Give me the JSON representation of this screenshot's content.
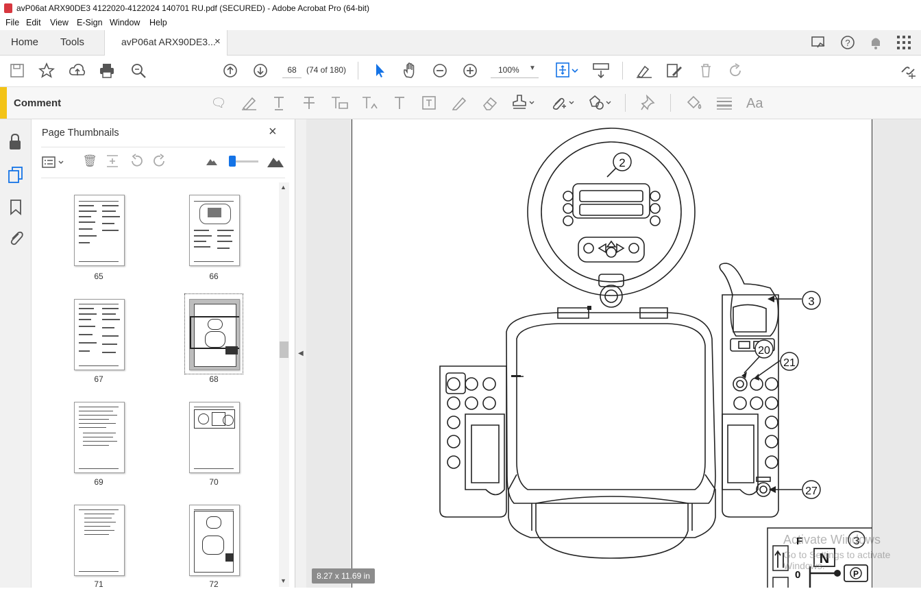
{
  "window": {
    "title": "avP06at ARX90DE3 4122020-4122024 140701 RU.pdf (SECURED) - Adobe Acrobat Pro (64-bit)"
  },
  "menu": {
    "items": [
      "File",
      "Edit",
      "View",
      "E-Sign",
      "Window",
      "Help"
    ]
  },
  "tabs": {
    "home": "Home",
    "tools": "Tools",
    "doc": "avP06at ARX90DE3...",
    "close": "×"
  },
  "toolbar": {
    "page_value": "68",
    "page_info": "(74 of 180)",
    "zoom": "100%"
  },
  "comment": {
    "label": "Comment"
  },
  "panel": {
    "title": "Page Thumbnails",
    "close": "×",
    "thumbnails": [
      "65",
      "66",
      "67",
      "68",
      "69",
      "70",
      "71",
      "72"
    ],
    "selected": "68"
  },
  "document": {
    "page_size": "8.27 x 11.69 in",
    "callouts": [
      "2",
      "3",
      "20",
      "21",
      "27",
      "3"
    ],
    "inset": {
      "f": "F",
      "n": "N",
      "zero": "0",
      "p": "P"
    }
  },
  "watermark": {
    "line1": "Activate Windows",
    "line2": "Go to Settings to activate Windows."
  }
}
